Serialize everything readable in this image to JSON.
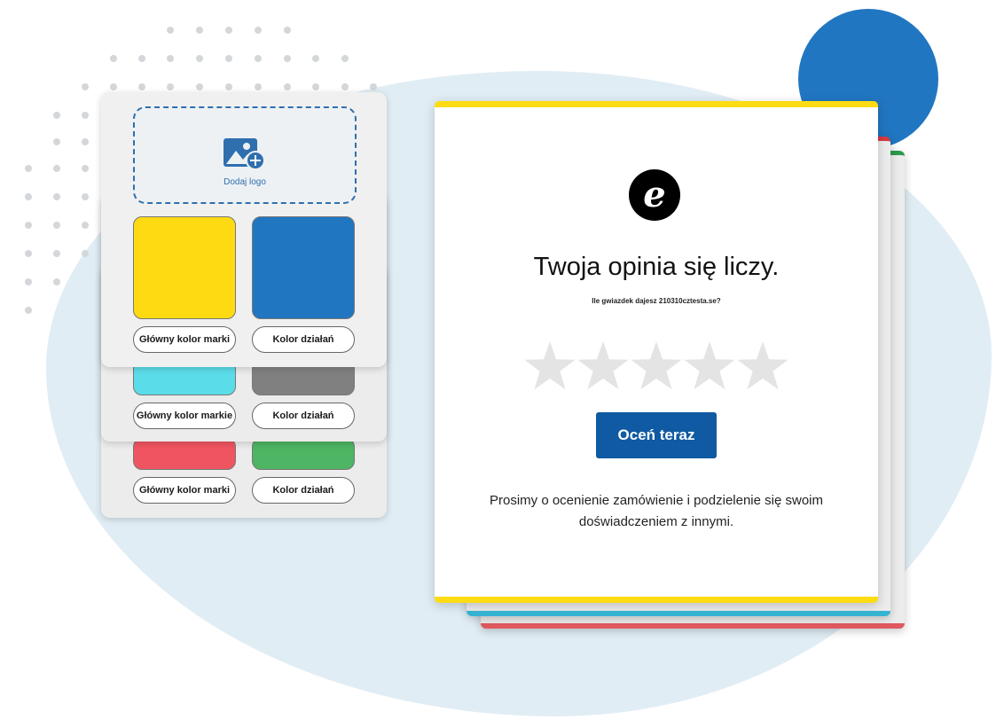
{
  "left_panels": {
    "logo_upload_label": "Dodaj logo",
    "front": {
      "brand_label": "Główny kolor marki",
      "action_label": "Kolor działań",
      "brand_color": "#fdda12",
      "action_color": "#2176c1"
    },
    "middle": {
      "brand_label": "Główny kolor markie",
      "action_label": "Kolor działań",
      "brand_color": "#5bdde9",
      "action_color": "#808080"
    },
    "back": {
      "brand_label": "Główny kolor marki",
      "action_label": "Kolor działań",
      "brand_color": "#ef5560",
      "action_color": "#4db563"
    }
  },
  "review_card": {
    "logo": "e",
    "title": "Twoja opinia się liczy.",
    "subtitle": "Ile gwiazdek dajesz 210310cztesta.se?",
    "star_count": 5,
    "rating_value": 0,
    "rate_button_label": "Oceń teraz",
    "body_text": "Prosimy o ocenienie zamówienie i podzielenie się swoim doświadczeniem z innymi."
  },
  "icons": {
    "add_image": "add-image-icon",
    "brand_logo": "trusted-shops-e-logo",
    "star": "star-icon"
  },
  "colors": {
    "background_blob": "#e1edf4",
    "accent_blue": "#2176c1",
    "button_blue": "#0f5aa2",
    "card_stripe": "#fddc14",
    "star_empty": "#e4e4e4"
  }
}
